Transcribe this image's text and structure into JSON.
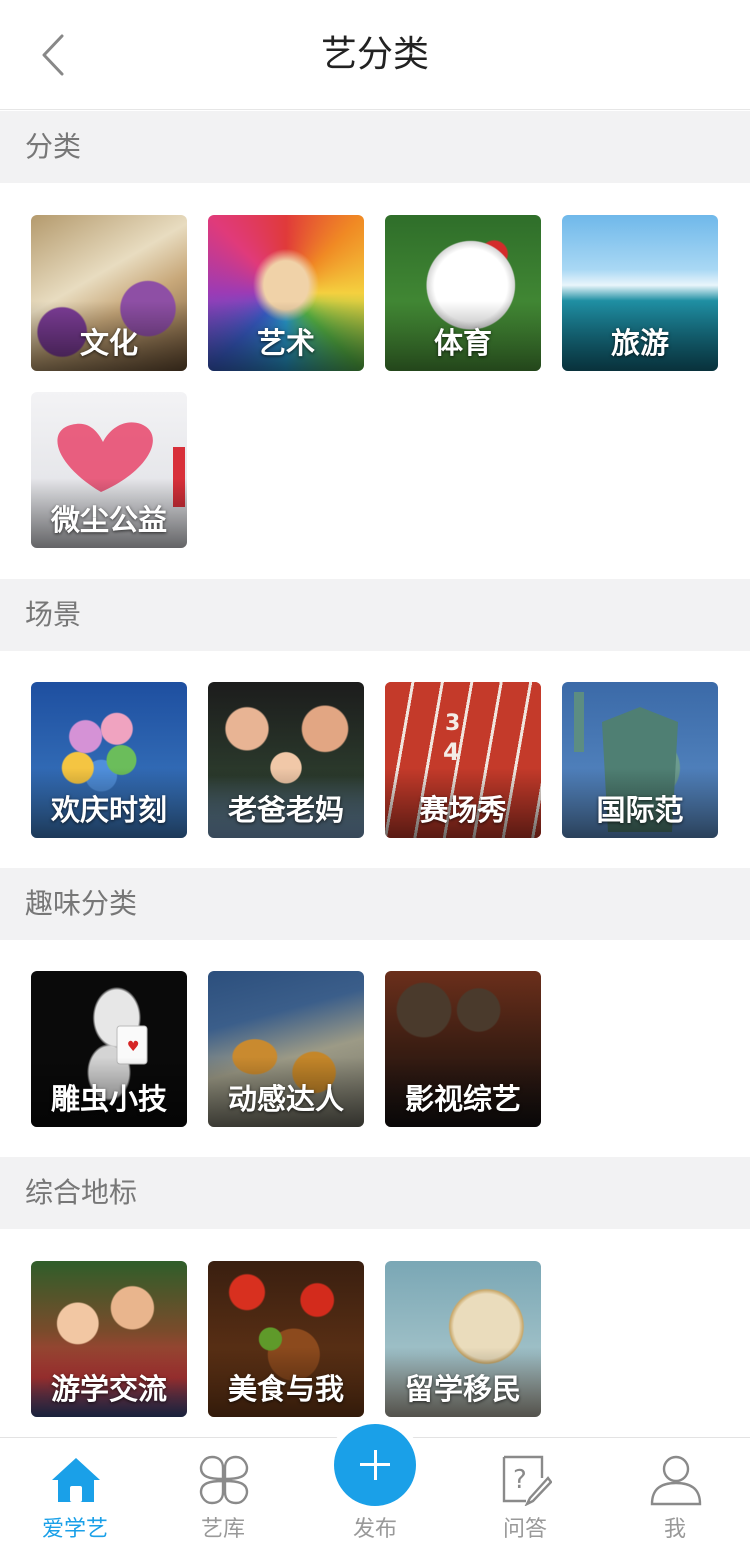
{
  "header": {
    "title": "艺分类"
  },
  "sections": [
    {
      "title": "分类",
      "items": [
        "文化",
        "艺术",
        "体育",
        "旅游",
        "微尘公益"
      ]
    },
    {
      "title": "场景",
      "items": [
        "欢庆时刻",
        "老爸老妈",
        "赛场秀",
        "国际范"
      ]
    },
    {
      "title": "趣味分类",
      "items": [
        "雕虫小技",
        "动感达人",
        "影视综艺"
      ]
    },
    {
      "title": "综合地标",
      "items": [
        "游学交流",
        "美食与我",
        "留学移民"
      ]
    }
  ],
  "tabs": [
    {
      "label": "爱学艺",
      "icon": "home-icon",
      "active": true
    },
    {
      "label": "艺库",
      "icon": "library-icon",
      "active": false
    },
    {
      "label": "发布",
      "icon": "plus-icon",
      "active": false
    },
    {
      "label": "问答",
      "icon": "question-icon",
      "active": false
    },
    {
      "label": "我",
      "icon": "person-icon",
      "active": false
    }
  ],
  "colors": {
    "accent": "#1aa0e8",
    "section_bg": "#f2f2f3",
    "inactive_tab": "#999999"
  }
}
